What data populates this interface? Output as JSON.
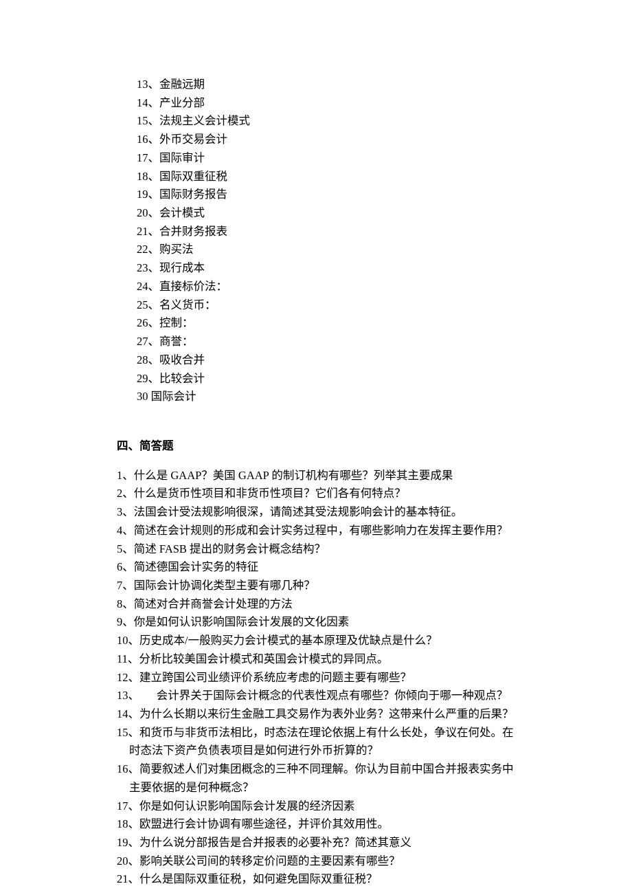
{
  "terms": [
    {
      "num": "13、",
      "text": "金融远期"
    },
    {
      "num": "14、",
      "text": "产业分部"
    },
    {
      "num": "15、",
      "text": "法规主义会计模式"
    },
    {
      "num": "16、",
      "text": "外币交易会计"
    },
    {
      "num": "17、",
      "text": "国际审计"
    },
    {
      "num": "18、",
      "text": "国际双重征税"
    },
    {
      "num": "19、",
      "text": "国际财务报告"
    },
    {
      "num": "20、",
      "text": "会计模式"
    },
    {
      "num": "21、",
      "text": "合并财务报表"
    },
    {
      "num": "22、",
      "text": "购买法"
    },
    {
      "num": "23、",
      "text": "现行成本"
    },
    {
      "num": "24、",
      "text": "直接标价法："
    },
    {
      "num": "25、",
      "text": "名义货币："
    },
    {
      "num": "26、",
      "text": "控制："
    },
    {
      "num": "27、",
      "text": "商誉："
    },
    {
      "num": "28、",
      "text": "吸收合并"
    },
    {
      "num": "29、",
      "text": "比较会计"
    },
    {
      "num": "30 ",
      "text": "国际会计"
    }
  ],
  "section_heading": "四、简答题",
  "questions": [
    {
      "text": "1、什么是 GAAP？美国 GAAP 的制订机构有哪些？列举其主要成果"
    },
    {
      "text": "2、什么是货币性项目和非货币性项目？它们各有何特点？"
    },
    {
      "text": "3、法国会计受法规影响很深，请简述其受法规影响会计的基本特征。"
    },
    {
      "text": "4、简述在会计规则的形成和会计实务过程中，有哪些影响力在发挥主要作用？"
    },
    {
      "text": "5、简述 FASB 提出的财务会计概念结构？"
    },
    {
      "text": "6、简述德国会计实务的特征"
    },
    {
      "text": "7、国际会计协调化类型主要有哪几种？"
    },
    {
      "text": "8、简述对合并商誉会计处理的方法"
    },
    {
      "text": "9、你是如何认识影响国际会计发展的文化因素"
    },
    {
      "text": "10、历史成本/一般购买力会计模式的基本原理及优缺点是什么？"
    },
    {
      "text": "11、分析比较美国会计模式和英国会计模式的异同点。"
    },
    {
      "text": "12、建立跨国公司业绩评价系统应考虑的问题主要有哪些？"
    },
    {
      "text": "13、　　会计界关于国际会计概念的代表性观点有哪些？你倾向于哪一种观点？"
    },
    {
      "text": "14、为什么长期以来衍生金融工具交易作为表外业务？这带来什么严重的后果？"
    },
    {
      "text": "15、和货币与非货币法相比，时态法在理论依据上有什么长处，争议在何处。在时态法下资产负债表项目是如何进行外币折算的？",
      "wrap": true
    },
    {
      "text": "16、简要叙述人们对集团概念的三种不同理解。你认为目前中国合并报表实务中主要依据的是何种概念？",
      "wrap": true
    },
    {
      "text": "17、你是如何认识影响国际会计发展的经济因素"
    },
    {
      "text": "18、欧盟进行会计协调有哪些途径，并评价其效用性。"
    },
    {
      "text": "19、为什么说分部报告是合并报表的必要补充？简述其意义"
    },
    {
      "text": "20、影响关联公司间的转移定价问题的主要因素有哪些？"
    },
    {
      "text": "21、什么是国际双重征税，如何避免国际双重征税？"
    }
  ]
}
